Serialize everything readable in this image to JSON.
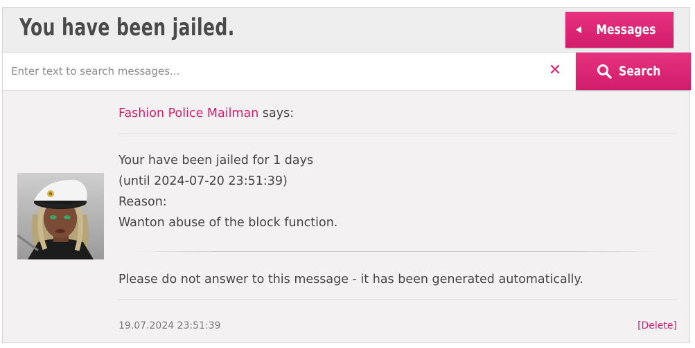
{
  "header": {
    "title": "You have been jailed.",
    "messages_button": "Messages"
  },
  "search": {
    "placeholder": "Enter text to search messages...",
    "value": "",
    "clear_symbol": "✕",
    "button_label": "Search"
  },
  "message": {
    "sender": "Fashion Police Mailman",
    "says": " says:",
    "lines": [
      "Your have been jailed for 1 days",
      "(until 2024-07-20 23:51:39)",
      "Reason:",
      "Wanton abuse of the block function."
    ],
    "auto_note": "Please do not answer to this message - it has been generated automatically.",
    "timestamp": "19.07.2024 23:51:39",
    "delete_label": "[Delete]"
  },
  "colors": {
    "accent": "#d21c6c",
    "panel_bg": "#f3f1f1",
    "header_bg": "#efeeee"
  },
  "icons": {
    "back": "triangle-left-icon",
    "search": "magnifier-icon",
    "clear": "close-x-icon"
  }
}
